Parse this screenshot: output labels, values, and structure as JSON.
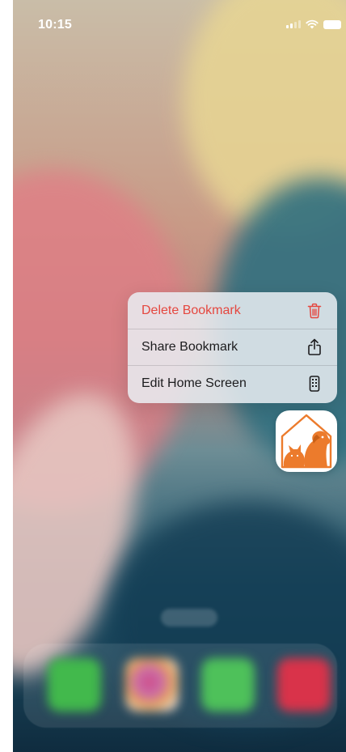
{
  "status_bar": {
    "time": "10:15"
  },
  "context_menu": {
    "items": [
      {
        "label": "Delete Bookmark",
        "icon": "trash-icon",
        "color": "#e5473f"
      },
      {
        "label": "Share Bookmark",
        "icon": "share-icon"
      },
      {
        "label": "Edit Home Screen",
        "icon": "phone-icon"
      }
    ]
  },
  "app_icon": {
    "icon": "pet-house-icon",
    "accent": "#ec7b2c"
  },
  "dock": {
    "apps": [
      "phone-app-icon",
      "photos-app-icon",
      "messages-app-icon",
      "music-app-icon"
    ]
  },
  "colors": {
    "destructive": "#e5473f",
    "menu_background": "#e9eef2",
    "brand_orange": "#ec7b2c"
  }
}
